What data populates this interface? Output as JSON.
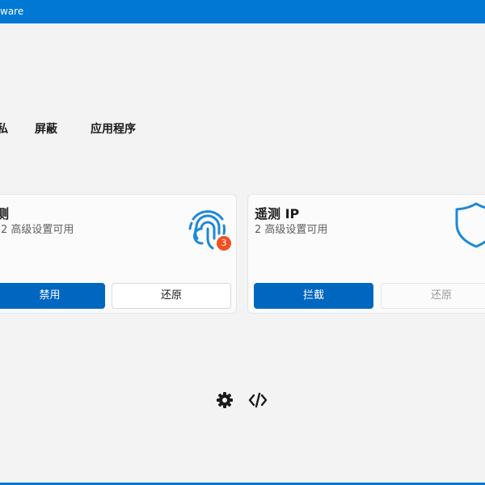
{
  "window": {
    "title": "ware"
  },
  "tabs": [
    {
      "label": "私"
    },
    {
      "label": "屏蔽"
    },
    {
      "label": "应用程序"
    }
  ],
  "cards": [
    {
      "title": "测",
      "subtitle": "2 高级设置可用",
      "icon": "fingerprint-icon",
      "badge": "3",
      "primary_label": "禁用",
      "secondary_label": "还原"
    },
    {
      "title": "遥测 IP",
      "subtitle": "2 高级设置可用",
      "icon": "shield-icon",
      "primary_label": "拦截",
      "secondary_label": "还原"
    }
  ],
  "footer": {
    "icons": [
      "gear-icon",
      "code-icon"
    ]
  },
  "colors": {
    "accent": "#0078d4",
    "button_primary": "#0067c0",
    "badge": "#f25022",
    "icon_blue": "#1e88d6"
  }
}
